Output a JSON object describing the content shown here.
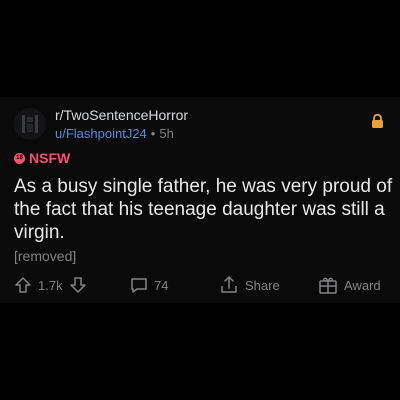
{
  "post": {
    "subreddit": "r/TwoSentenceHorror",
    "author": "u/FlashpointJ24",
    "separator": "•",
    "age": "5h",
    "nsfw_label": "NSFW",
    "nsfw_badge": "18",
    "title": "As a busy single father, he was very proud of the fact that his teenage daughter was still a virgin.",
    "body": "[removed]"
  },
  "actions": {
    "score": "1.7k",
    "comments": "74",
    "share_label": "Share",
    "award_label": "Award"
  },
  "colors": {
    "background": "#000000",
    "card": "#0a0a0b",
    "author_link": "#4f8dd6",
    "nsfw": "#ff4f70",
    "lock": "#e8a13a",
    "muted": "#818384"
  },
  "icons": [
    "subreddit-avatar-icon",
    "lock-icon",
    "nsfw-icon",
    "upvote-icon",
    "downvote-icon",
    "comment-icon",
    "share-icon",
    "award-icon"
  ]
}
